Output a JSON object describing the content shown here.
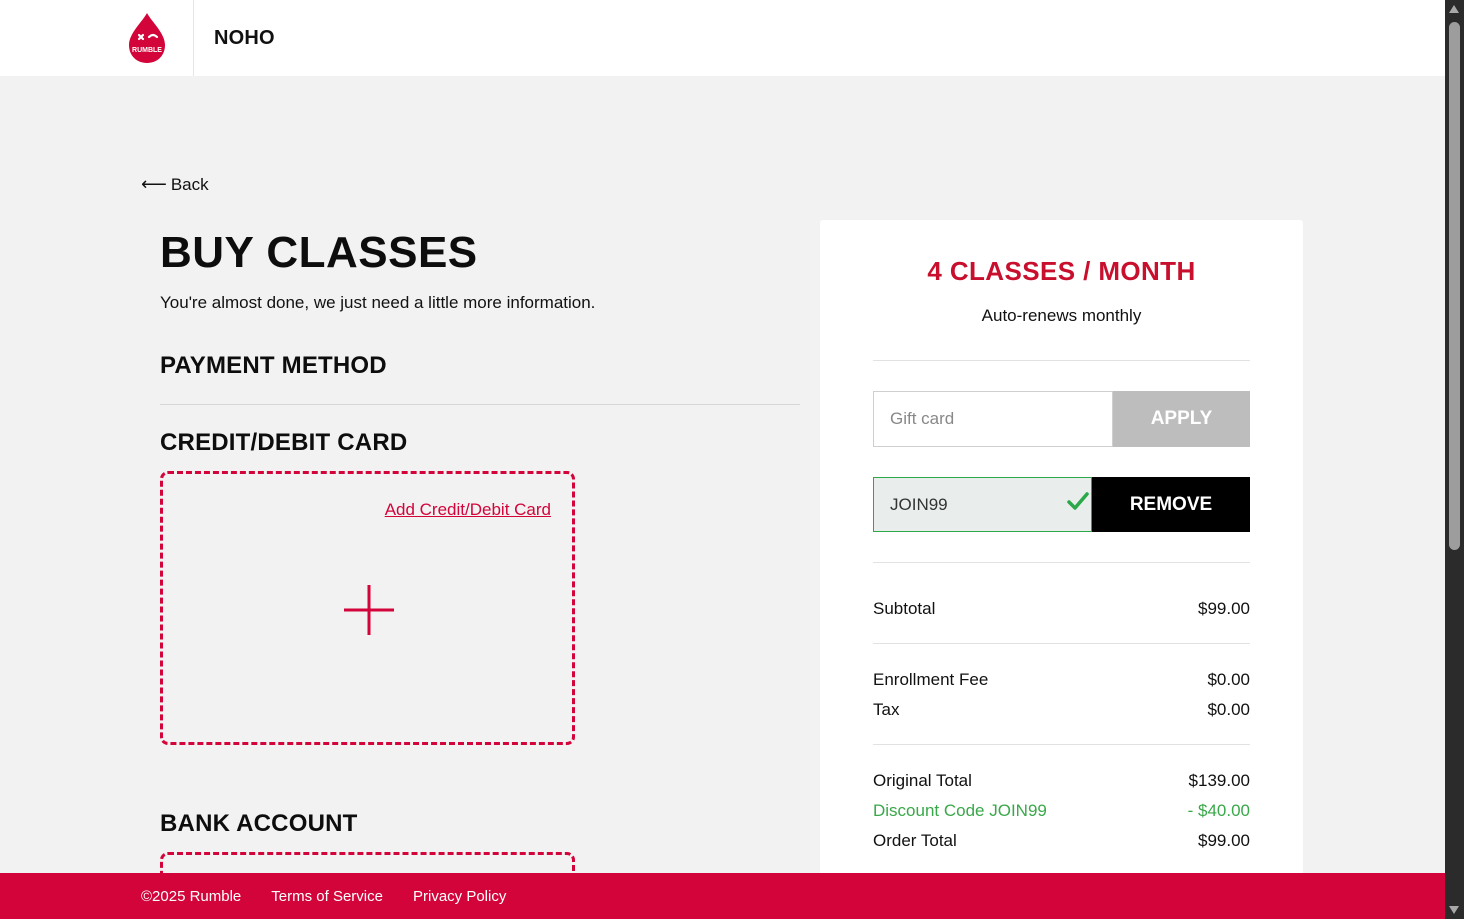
{
  "header": {
    "location": "NOHO",
    "logo_text": "RUMBLE"
  },
  "nav": {
    "back_label": "Back"
  },
  "page": {
    "title": "BUY CLASSES",
    "subtitle": "You're almost done, we just need a little more information."
  },
  "payment": {
    "section_title": "PAYMENT METHOD",
    "card_title": "CREDIT/DEBIT CARD",
    "add_card_label": "Add Credit/Debit Card",
    "bank_title": "BANK ACCOUNT"
  },
  "order": {
    "plan_name": "4 CLASSES / MONTH",
    "plan_sub": "Auto-renews monthly",
    "gift_placeholder": "Gift card",
    "apply_label": "APPLY",
    "promo_value": "JOIN99",
    "remove_label": "REMOVE",
    "lines": {
      "subtotal_label": "Subtotal",
      "subtotal_value": "$99.00",
      "enroll_label": "Enrollment Fee",
      "enroll_value": "$0.00",
      "tax_label": "Tax",
      "tax_value": "$0.00",
      "original_label": "Original Total",
      "original_value": "$139.00",
      "discount_label": "Discount Code JOIN99",
      "discount_value": "- $40.00",
      "total_label": "Order Total",
      "total_value": "$99.00"
    }
  },
  "footer": {
    "copyright": "©2025 Rumble",
    "terms": "Terms of Service",
    "privacy": "Privacy Policy"
  },
  "colors": {
    "brand_red": "#d2043a",
    "success_green": "#3aa84a",
    "disabled_gray": "#bdbdbd"
  }
}
